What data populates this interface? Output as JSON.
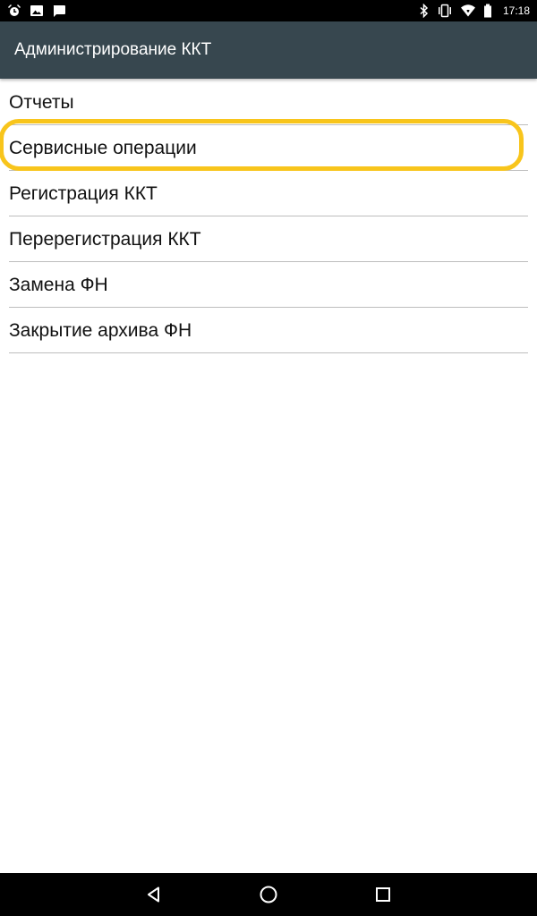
{
  "status_bar": {
    "time": "17:18",
    "left_icons": [
      "alarm-icon",
      "image-icon",
      "message-icon"
    ],
    "right_icons": [
      "bluetooth-icon",
      "vibrate-icon",
      "wifi-icon",
      "battery-icon"
    ]
  },
  "app_bar": {
    "title": "Администрирование ККТ",
    "background": "#37474f"
  },
  "menu": {
    "items": [
      {
        "label": "Отчеты"
      },
      {
        "label": "Сервисные операции",
        "highlighted": true
      },
      {
        "label": "Регистрация ККТ"
      },
      {
        "label": "Перерегистрация ККТ"
      },
      {
        "label": "Замена ФН"
      },
      {
        "label": "Закрытие архива ФН"
      }
    ],
    "highlight_color": "#f8c51c"
  },
  "nav_bar": {
    "buttons": [
      "back-icon",
      "home-icon",
      "recents-icon"
    ]
  }
}
